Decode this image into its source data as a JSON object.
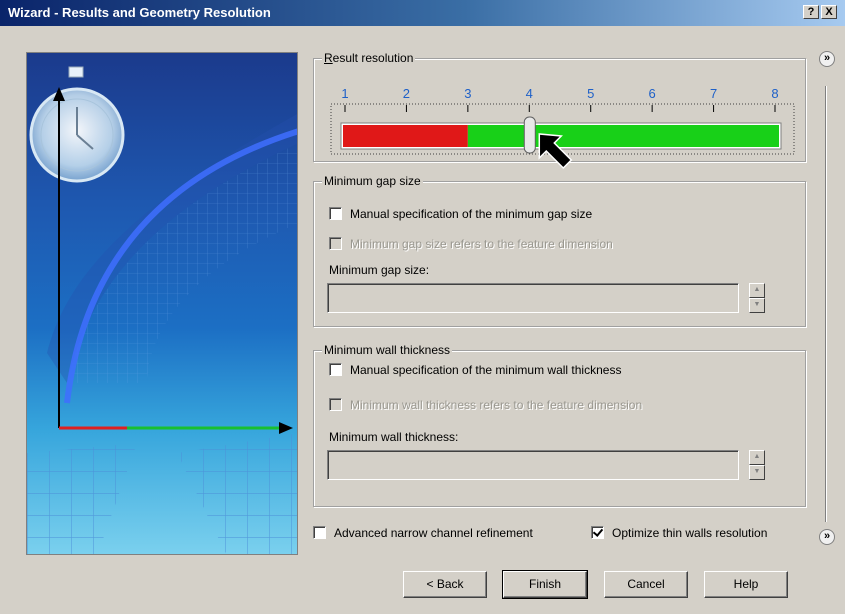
{
  "window": {
    "title": "Wizard - Results and Geometry Resolution",
    "help_btn": "?",
    "close_btn": "X"
  },
  "result_resolution": {
    "legend": "Result resolution",
    "ticks": [
      "1",
      "2",
      "3",
      "4",
      "5",
      "6",
      "7",
      "8"
    ],
    "value": 4,
    "colors": {
      "low": "#e01818",
      "high": "#18d018",
      "tick": "#1e60c8"
    }
  },
  "min_gap": {
    "legend": "Minimum gap size",
    "manual_label": "Manual specification of the minimum gap size",
    "manual_checked": false,
    "feature_label": "Minimum gap size refers to the feature dimension",
    "feature_checked": false,
    "field_label": "Minimum gap size:",
    "field_value": ""
  },
  "min_wall": {
    "legend": "Minimum wall thickness",
    "manual_label": "Manual specification of the minimum wall thickness",
    "manual_checked": false,
    "feature_label": "Minimum wall thickness refers to the feature dimension",
    "feature_checked": false,
    "field_label": "Minimum wall thickness:",
    "field_value": ""
  },
  "options": {
    "narrow_channel_label": "Advanced narrow channel refinement",
    "narrow_channel_checked": false,
    "thin_walls_label": "Optimize thin walls resolution",
    "thin_walls_checked": true
  },
  "buttons": {
    "back": "< Back",
    "finish": "Finish",
    "cancel": "Cancel",
    "help": "Help"
  },
  "side_icons": {
    "top": "»",
    "bottom": "»"
  }
}
